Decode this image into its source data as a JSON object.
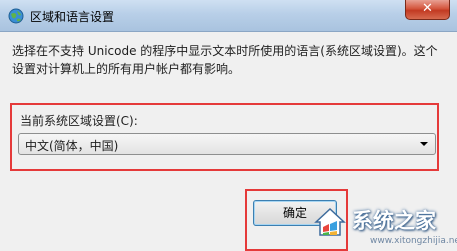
{
  "window": {
    "title": "区域和语言设置",
    "close_glyph": "✕",
    "title_icon": "globe-icon"
  },
  "description": "选择在不支持 Unicode 的程序中显示文本时所使用的语言(系统区域设置)。这个设置对计算机上的所有用户帐户都有影响。",
  "locale": {
    "label": "当前系统区域设置(C):",
    "selected": "中文(简体，中国)"
  },
  "buttons": {
    "ok_label": "确定"
  },
  "watermark": {
    "text": "系统之家",
    "url": "www.xitongzhijia.net"
  },
  "colors": {
    "highlight": "#e53a3a",
    "titlebar": "#b8cfe8",
    "close_button": "#c23a22"
  }
}
